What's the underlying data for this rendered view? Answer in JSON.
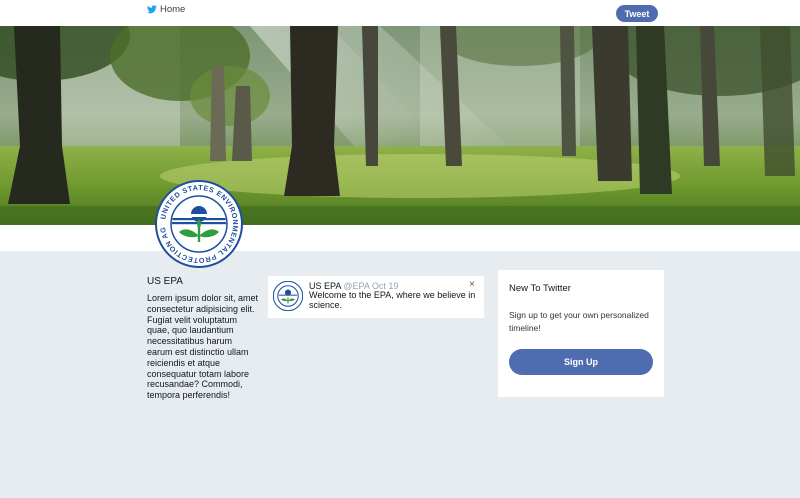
{
  "nav": {
    "home_label": "Home",
    "tweet_label": "Tweet"
  },
  "avatar": {
    "seal_text": "UNITED STATES ENVIRONMENTAL PROTECTION AGENCY"
  },
  "profile": {
    "name": "US EPA",
    "bio": "Lorem ipsum dolor sit, amet consectetur adipisicing elit. Fugiat velit voluptatum quae, quo laudantium necessitatibus harum earum est distinctio ullam reiciendis et atque consequatur totam labore recusandae? Commodi, tempora perferendis!"
  },
  "tweet": {
    "name": "US EPA",
    "handle": "@EPA",
    "date": "Oct 19",
    "text": "Welcome to the EPA, where we believe in science.",
    "close_symbol": "×"
  },
  "signup": {
    "title": "New To Twitter",
    "description": "Sign up to get your own personalized timeline!",
    "button_label": "Sign Up"
  },
  "colors": {
    "accent": "#4f6cb0",
    "page_bg": "#e6ecf0",
    "twitter_blue": "#1da1f2",
    "seal_blue": "#1d4f9c"
  }
}
